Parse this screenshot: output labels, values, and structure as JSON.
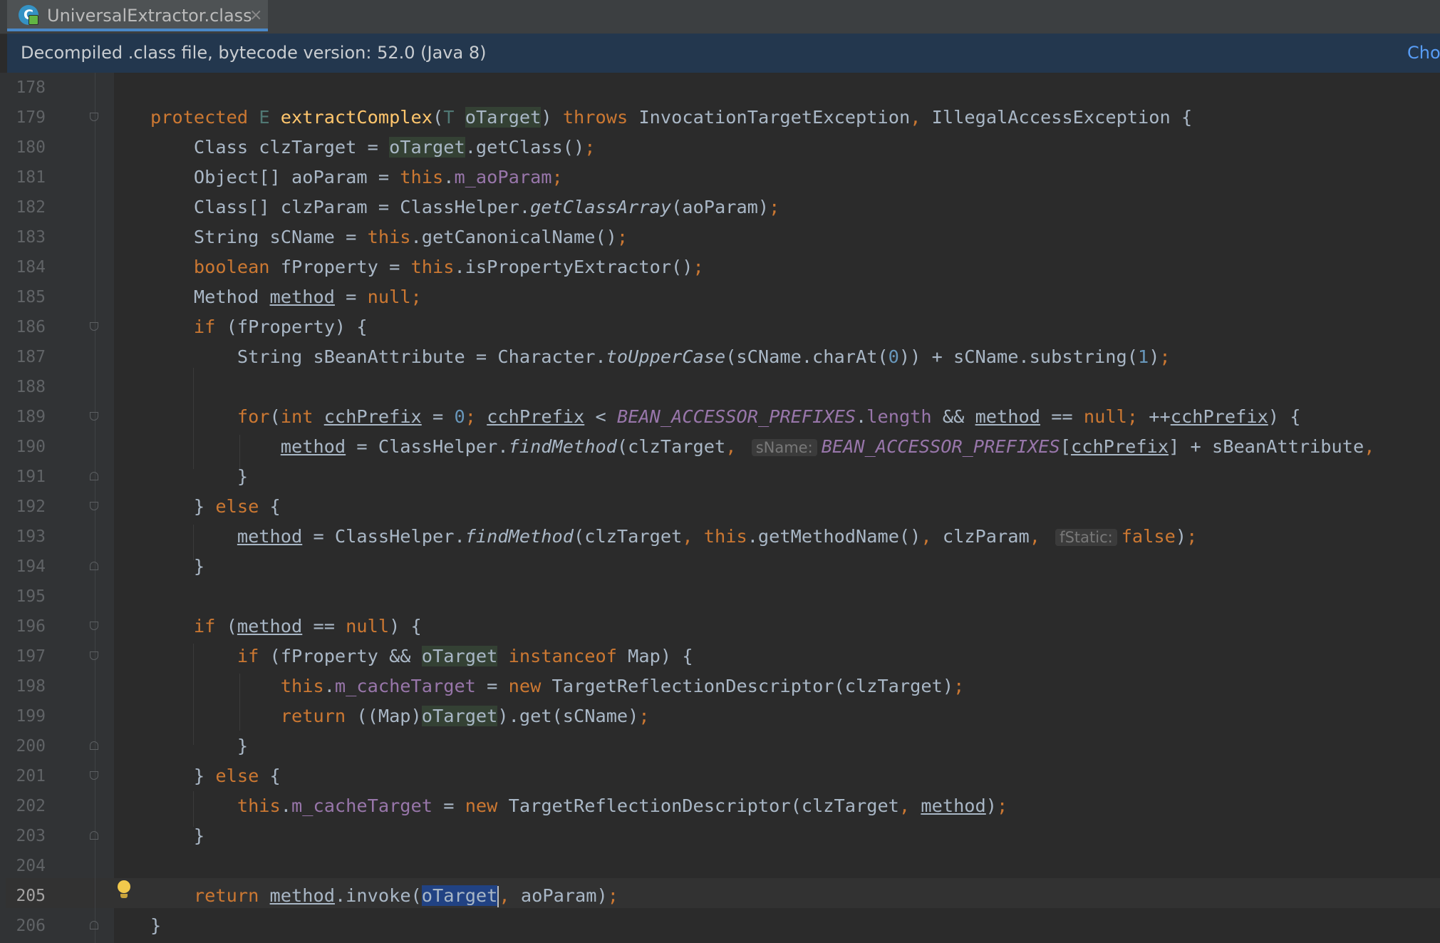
{
  "tab": {
    "icon": "class-file-icon",
    "icon_letter": "C",
    "label": "UniversalExtractor.class",
    "close_glyph": "×"
  },
  "banner": {
    "text": "Decompiled .class file, bytecode version: 52.0 (Java 8)",
    "link": "Cho"
  },
  "editor": {
    "current_line": 205,
    "colors": {
      "background": "#2b2b2b",
      "keyword": "#cc7832",
      "method_decl": "#ffc66d",
      "number": "#6897bb",
      "field": "#9876aa",
      "text": "#a9b7c6",
      "selection": "#214283",
      "usage_highlight": "#344134"
    },
    "lines": [
      {
        "num": "178",
        "fold": "",
        "segs": []
      },
      {
        "num": "179",
        "fold": "open",
        "segs": [
          {
            "t": "protected ",
            "c": "kw"
          },
          {
            "t": "E ",
            "c": "gen"
          },
          {
            "t": "extractComplex",
            "c": "fn"
          },
          {
            "t": "("
          },
          {
            "t": "T ",
            "c": "gen"
          },
          {
            "t": "oTarget",
            "c": "hl"
          },
          {
            "t": ") "
          },
          {
            "t": "throws ",
            "c": "kw"
          },
          {
            "t": "InvocationTargetException"
          },
          {
            "t": ", ",
            "c": "kw"
          },
          {
            "t": "IllegalAccessException {"
          }
        ]
      },
      {
        "num": "180",
        "fold": "",
        "segs": [
          {
            "t": "    Class clzTarget = "
          },
          {
            "t": "oTarget",
            "c": "hl"
          },
          {
            "t": ".getClass()"
          },
          {
            "t": ";",
            "c": "kw"
          }
        ]
      },
      {
        "num": "181",
        "fold": "",
        "segs": [
          {
            "t": "    Object[] aoParam = "
          },
          {
            "t": "this",
            "c": "kw"
          },
          {
            "t": "."
          },
          {
            "t": "m_aoParam",
            "c": "fld"
          },
          {
            "t": ";",
            "c": "kw"
          }
        ]
      },
      {
        "num": "182",
        "fold": "",
        "segs": [
          {
            "t": "    Class[] clzParam = ClassHelper."
          },
          {
            "t": "getClassArray",
            "c": "st"
          },
          {
            "t": "(aoParam)"
          },
          {
            "t": ";",
            "c": "kw"
          }
        ]
      },
      {
        "num": "183",
        "fold": "",
        "segs": [
          {
            "t": "    String sCName = "
          },
          {
            "t": "this",
            "c": "kw"
          },
          {
            "t": ".getCanonicalName()"
          },
          {
            "t": ";",
            "c": "kw"
          }
        ]
      },
      {
        "num": "184",
        "fold": "",
        "segs": [
          {
            "t": "    "
          },
          {
            "t": "boolean ",
            "c": "kw"
          },
          {
            "t": "fProperty = "
          },
          {
            "t": "this",
            "c": "kw"
          },
          {
            "t": ".isPropertyExtractor()"
          },
          {
            "t": ";",
            "c": "kw"
          }
        ]
      },
      {
        "num": "185",
        "fold": "",
        "segs": [
          {
            "t": "    Method "
          },
          {
            "t": "method",
            "c": "u"
          },
          {
            "t": " = "
          },
          {
            "t": "null;",
            "c": "kw"
          }
        ]
      },
      {
        "num": "186",
        "fold": "open",
        "segs": [
          {
            "t": "    "
          },
          {
            "t": "if ",
            "c": "kw"
          },
          {
            "t": "(fProperty) {"
          }
        ]
      },
      {
        "num": "187",
        "fold": "",
        "segs": [
          {
            "t": "        String sBeanAttribute = Character."
          },
          {
            "t": "toUpperCase",
            "c": "st"
          },
          {
            "t": "(sCName.charAt("
          },
          {
            "t": "0",
            "c": "num"
          },
          {
            "t": ")) + sCName.substring("
          },
          {
            "t": "1",
            "c": "num"
          },
          {
            "t": ")"
          },
          {
            "t": ";",
            "c": "kw"
          }
        ]
      },
      {
        "num": "188",
        "fold": "",
        "segs": []
      },
      {
        "num": "189",
        "fold": "open",
        "segs": [
          {
            "t": "        "
          },
          {
            "t": "for",
            "c": "kw"
          },
          {
            "t": "("
          },
          {
            "t": "int ",
            "c": "kw"
          },
          {
            "t": "cchPrefix",
            "c": "u"
          },
          {
            "t": " = "
          },
          {
            "t": "0",
            "c": "num"
          },
          {
            "t": "; ",
            "c": "kw"
          },
          {
            "t": "cchPrefix",
            "c": "u"
          },
          {
            "t": " < "
          },
          {
            "t": "BEAN_ACCESSOR_PREFIXES",
            "c": "fld st"
          },
          {
            "t": "."
          },
          {
            "t": "length",
            "c": "fld"
          },
          {
            "t": " && "
          },
          {
            "t": "method",
            "c": "u"
          },
          {
            "t": " == "
          },
          {
            "t": "null; ",
            "c": "kw"
          },
          {
            "t": "++"
          },
          {
            "t": "cchPrefix",
            "c": "u"
          },
          {
            "t": ") {"
          }
        ]
      },
      {
        "num": "190",
        "fold": "",
        "segs": [
          {
            "t": "            "
          },
          {
            "t": "method",
            "c": "u"
          },
          {
            "t": " = ClassHelper."
          },
          {
            "t": "findMethod",
            "c": "st"
          },
          {
            "t": "(clzTarget"
          },
          {
            "t": ", ",
            "c": "kw"
          },
          {
            "t": "sName:",
            "c": "hint"
          },
          {
            "t": "BEAN_ACCESSOR_PREFIXES",
            "c": "fld st"
          },
          {
            "t": "["
          },
          {
            "t": "cchPrefix",
            "c": "u"
          },
          {
            "t": "] + sBeanAttribute"
          },
          {
            "t": ",",
            "c": "kw"
          }
        ]
      },
      {
        "num": "191",
        "fold": "close",
        "segs": [
          {
            "t": "        }"
          }
        ]
      },
      {
        "num": "192",
        "fold": "open",
        "segs": [
          {
            "t": "    } "
          },
          {
            "t": "else ",
            "c": "kw"
          },
          {
            "t": "{"
          }
        ]
      },
      {
        "num": "193",
        "fold": "",
        "segs": [
          {
            "t": "        "
          },
          {
            "t": "method",
            "c": "u"
          },
          {
            "t": " = ClassHelper."
          },
          {
            "t": "findMethod",
            "c": "st"
          },
          {
            "t": "(clzTarget"
          },
          {
            "t": ", ",
            "c": "kw"
          },
          {
            "t": "this",
            "c": "kw"
          },
          {
            "t": ".getMethodName()"
          },
          {
            "t": ", ",
            "c": "kw"
          },
          {
            "t": "clzParam"
          },
          {
            "t": ", ",
            "c": "kw"
          },
          {
            "t": "fStatic:",
            "c": "hint"
          },
          {
            "t": "false",
            "c": "kw"
          },
          {
            "t": ")"
          },
          {
            "t": ";",
            "c": "kw"
          }
        ]
      },
      {
        "num": "194",
        "fold": "close",
        "segs": [
          {
            "t": "    }"
          }
        ]
      },
      {
        "num": "195",
        "fold": "",
        "segs": []
      },
      {
        "num": "196",
        "fold": "open",
        "segs": [
          {
            "t": "    "
          },
          {
            "t": "if ",
            "c": "kw"
          },
          {
            "t": "("
          },
          {
            "t": "method",
            "c": "u"
          },
          {
            "t": " == "
          },
          {
            "t": "null",
            "c": "kw"
          },
          {
            "t": ") {"
          }
        ]
      },
      {
        "num": "197",
        "fold": "open",
        "segs": [
          {
            "t": "        "
          },
          {
            "t": "if ",
            "c": "kw"
          },
          {
            "t": "(fProperty && "
          },
          {
            "t": "oTarget",
            "c": "hl"
          },
          {
            "t": " "
          },
          {
            "t": "instanceof ",
            "c": "kw"
          },
          {
            "t": "Map) {"
          }
        ]
      },
      {
        "num": "198",
        "fold": "",
        "segs": [
          {
            "t": "            "
          },
          {
            "t": "this",
            "c": "kw"
          },
          {
            "t": "."
          },
          {
            "t": "m_cacheTarget",
            "c": "fld"
          },
          {
            "t": " = "
          },
          {
            "t": "new ",
            "c": "kw"
          },
          {
            "t": "TargetReflectionDescriptor(clzTarget)"
          },
          {
            "t": ";",
            "c": "kw"
          }
        ]
      },
      {
        "num": "199",
        "fold": "",
        "segs": [
          {
            "t": "            "
          },
          {
            "t": "return ",
            "c": "kw"
          },
          {
            "t": "((Map)"
          },
          {
            "t": "oTarget",
            "c": "hl"
          },
          {
            "t": ").get(sCName)"
          },
          {
            "t": ";",
            "c": "kw"
          }
        ]
      },
      {
        "num": "200",
        "fold": "close",
        "segs": [
          {
            "t": "        }"
          }
        ]
      },
      {
        "num": "201",
        "fold": "open",
        "segs": [
          {
            "t": "    } "
          },
          {
            "t": "else ",
            "c": "kw"
          },
          {
            "t": "{"
          }
        ]
      },
      {
        "num": "202",
        "fold": "",
        "segs": [
          {
            "t": "        "
          },
          {
            "t": "this",
            "c": "kw"
          },
          {
            "t": "."
          },
          {
            "t": "m_cacheTarget",
            "c": "fld"
          },
          {
            "t": " = "
          },
          {
            "t": "new ",
            "c": "kw"
          },
          {
            "t": "TargetReflectionDescriptor(clzTarget"
          },
          {
            "t": ", ",
            "c": "kw"
          },
          {
            "t": "method",
            "c": "u"
          },
          {
            "t": ")"
          },
          {
            "t": ";",
            "c": "kw"
          }
        ]
      },
      {
        "num": "203",
        "fold": "close",
        "segs": [
          {
            "t": "    }"
          }
        ]
      },
      {
        "num": "204",
        "fold": "",
        "segs": []
      },
      {
        "num": "205",
        "fold": "",
        "bulb": true,
        "segs": [
          {
            "t": "    "
          },
          {
            "t": "return ",
            "c": "kw"
          },
          {
            "t": "method",
            "c": "u"
          },
          {
            "t": ".invoke("
          },
          {
            "t": "oTarget",
            "c": "sel",
            "caret": true
          },
          {
            "t": ", ",
            "c": "kw"
          },
          {
            "t": "aoParam)"
          },
          {
            "t": ";",
            "c": "kw"
          }
        ]
      },
      {
        "num": "206",
        "fold": "close",
        "segs": [
          {
            "t": "}"
          }
        ]
      }
    ]
  }
}
